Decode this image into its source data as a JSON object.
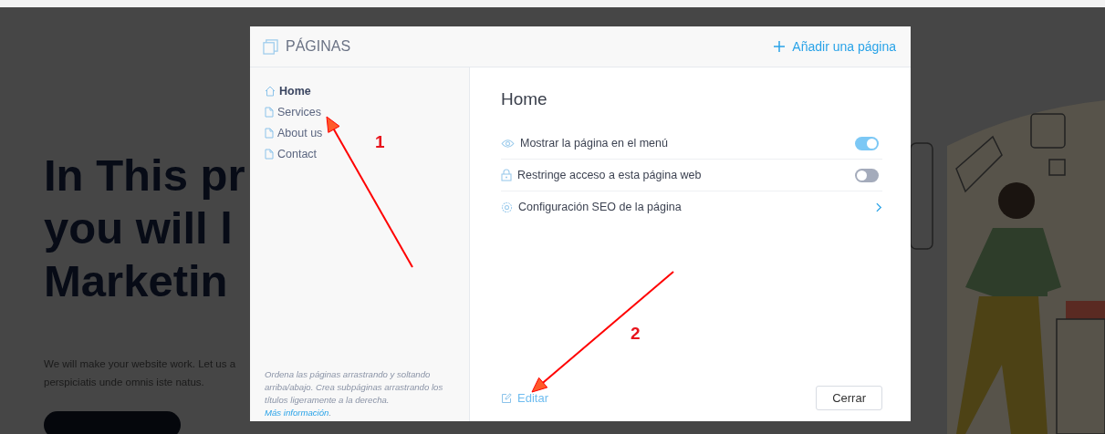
{
  "background": {
    "heading_lines": [
      "In This pr",
      "you will l",
      "Marketin"
    ],
    "paragraph_lines": [
      "We will make your website work. Let us a",
      "perspiciatis unde omnis iste natus."
    ]
  },
  "dialog": {
    "title": "PÁGINAS",
    "add_button": "Añadir una página",
    "pages": [
      {
        "name": "Home",
        "kind": "home",
        "selected": true
      },
      {
        "name": "Services",
        "kind": "page",
        "selected": false
      },
      {
        "name": "About us",
        "kind": "page",
        "selected": false
      },
      {
        "name": "Contact",
        "kind": "page",
        "selected": false
      }
    ],
    "help_text": "Ordena las páginas arrastrando y soltando arriba/abajo. Crea subpáginas arrastrando los títulos ligeramente a la derecha.",
    "help_link": "Más información",
    "help_end": ".",
    "page_title": "Home",
    "settings": [
      {
        "kind": "toggle",
        "label": "Mostrar la página en el menú",
        "on": true
      },
      {
        "kind": "toggle",
        "label": "Restringe acceso a esta página web",
        "on": false
      },
      {
        "kind": "link",
        "label": "Configuración SEO de la página"
      }
    ],
    "edit_button": "Editar",
    "close_button": "Cerrar"
  },
  "annotations": [
    {
      "label": "1"
    },
    {
      "label": "2"
    }
  ]
}
